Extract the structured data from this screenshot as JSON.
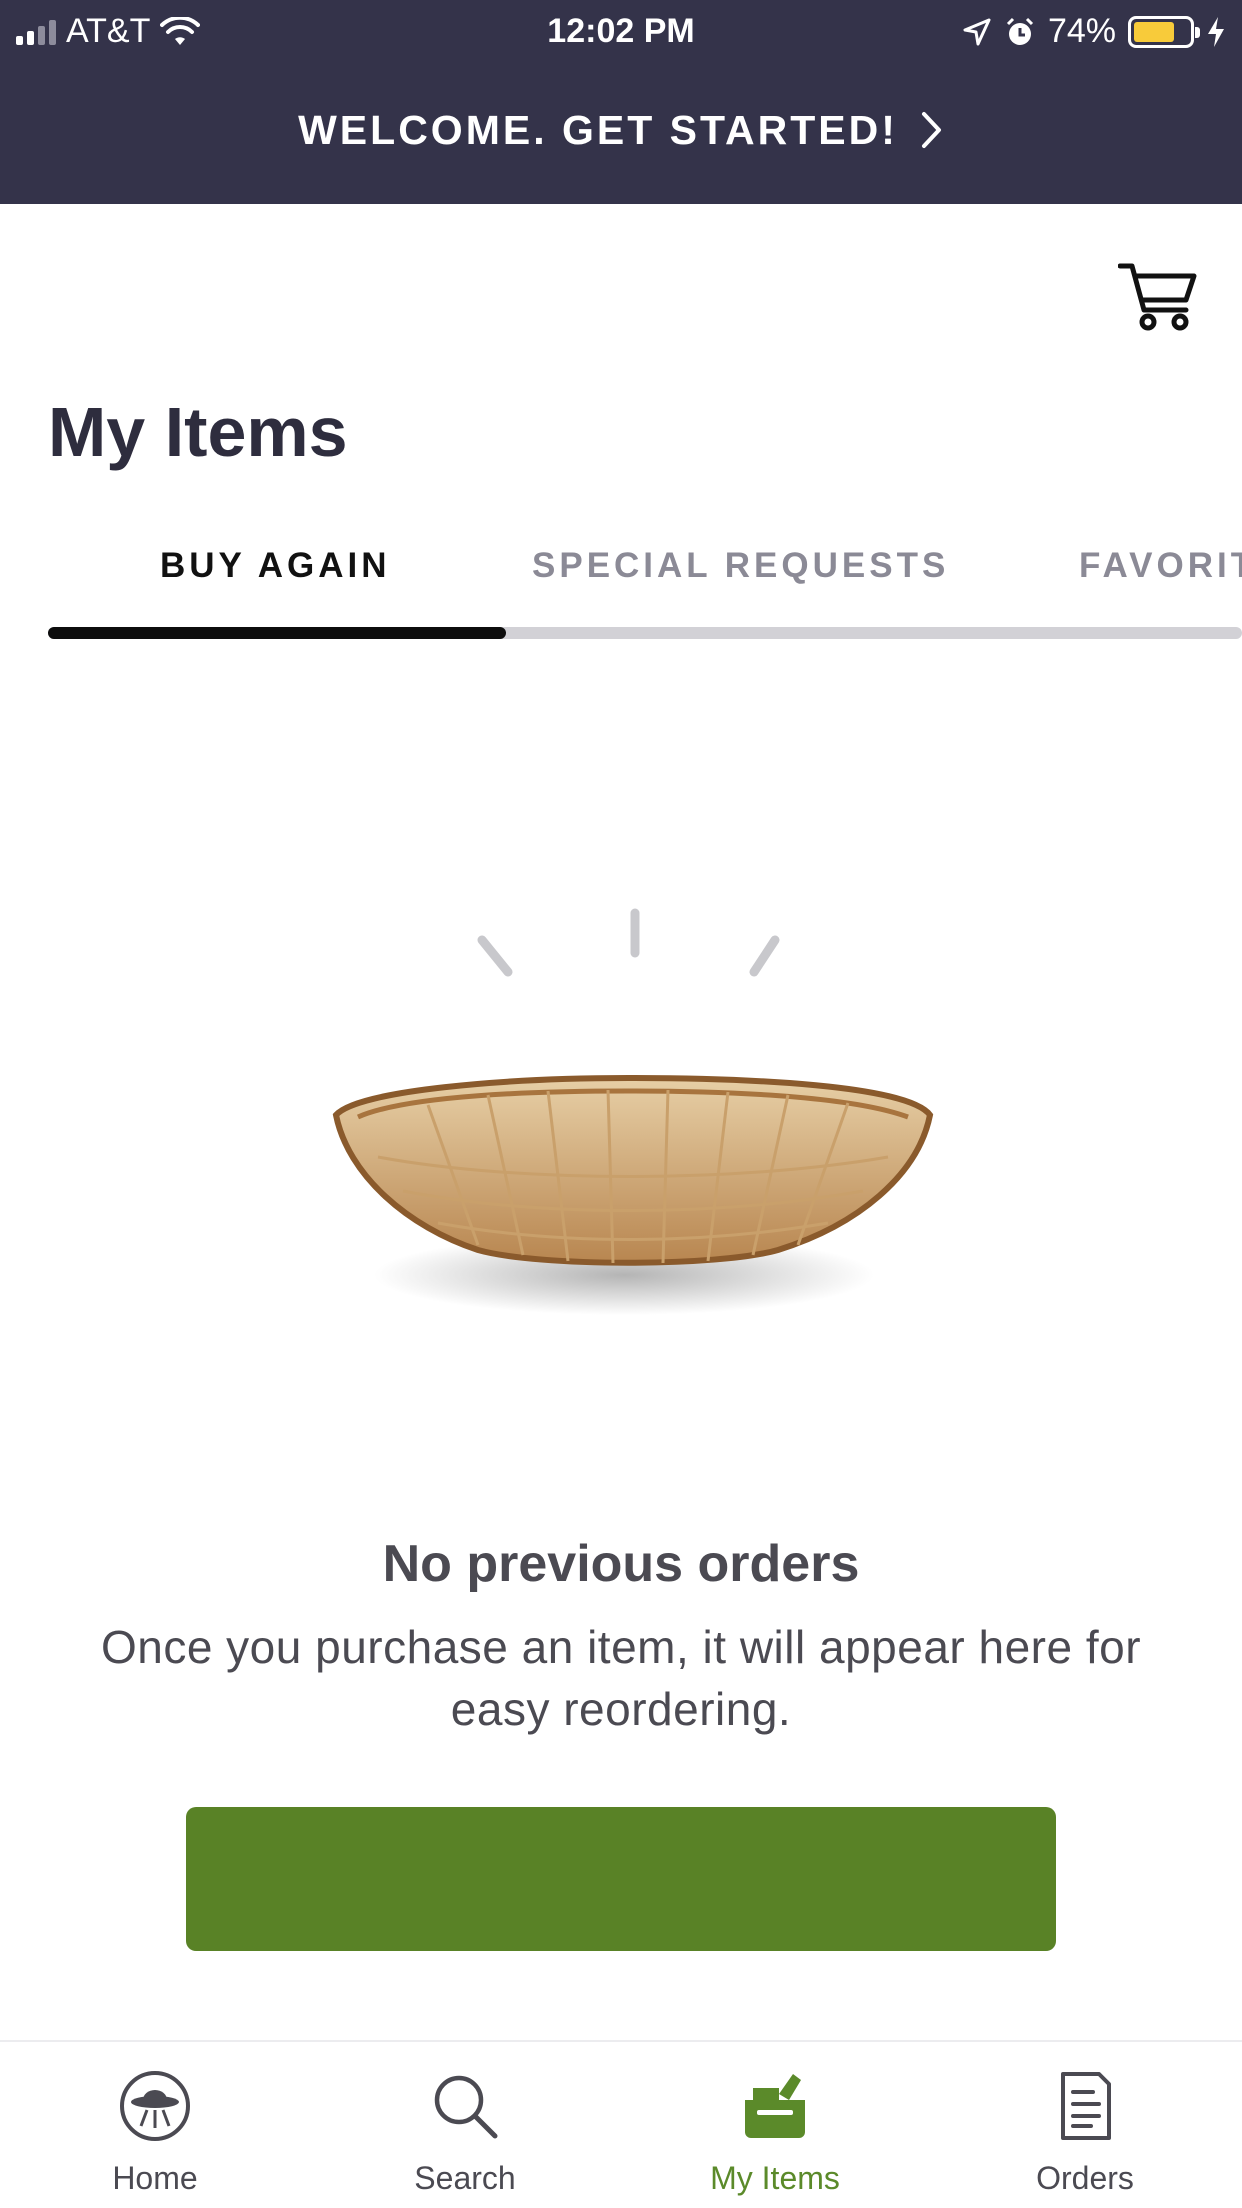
{
  "status_bar": {
    "carrier": "AT&T",
    "time": "12:02 PM",
    "battery": "74%",
    "battery_level": 0.74,
    "icons": [
      "signal-icon",
      "wifi-icon",
      "location-icon",
      "alarm-icon",
      "battery-icon",
      "charging-icon"
    ]
  },
  "banner": {
    "text": "WELCOME. GET STARTED!",
    "icon": "chevron-right-icon"
  },
  "header": {
    "cart_icon": "cart-icon"
  },
  "page": {
    "title": "My Items"
  },
  "tabs": [
    {
      "label": "BUY AGAIN",
      "active": true
    },
    {
      "label": "SPECIAL REQUESTS",
      "active": false
    },
    {
      "label": "FAVORIT",
      "active": false
    }
  ],
  "empty_state": {
    "title": "No previous orders",
    "message": "Once you purchase an item, it will appear here for easy reordering.",
    "button_label": ""
  },
  "bottom_nav": [
    {
      "label": "Home",
      "icon": "home-ufo-icon",
      "active": false
    },
    {
      "label": "Search",
      "icon": "search-icon",
      "active": false
    },
    {
      "label": "My Items",
      "icon": "bag-icon",
      "active": true
    },
    {
      "label": "Orders",
      "icon": "receipt-icon",
      "active": false
    }
  ],
  "colors": {
    "banner_bg": "#34334a",
    "accent_green": "#598226",
    "tab_active": "#0d0d0d",
    "tab_inactive": "#8b8a96"
  }
}
